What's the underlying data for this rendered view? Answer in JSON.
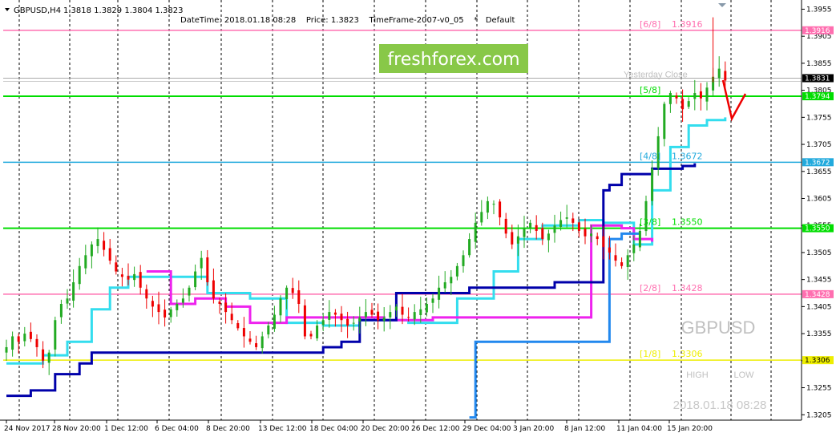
{
  "header": {
    "symbol": "GBPUSD,H4",
    "ohlc": "1.3818 1.3829 1.3804 1.3823",
    "indicator_info": "DateTime: 2018.01.18 08:28    Price: 1.3823    TimeFrame-2007-v0_05    *   Default"
  },
  "watermark": {
    "logo": "freshforex.com",
    "symbol": "GBPUSD",
    "high": "HIGH",
    "low": "LOW",
    "datetime": "2018.01.18 08:28"
  },
  "colors": {
    "bull": "#22aa22",
    "bear": "#ee0000",
    "level_pink": "#ff6fb0",
    "level_green": "#00dd00",
    "level_cyan": "#22aadd",
    "level_yellow": "#eeee00",
    "cyan_line": "#33ddee",
    "magenta_line": "#ee22ee",
    "navy_line": "#0000aa",
    "blue_line": "#2288ee",
    "logo_bg": "#88c848",
    "arrow": "#ee0000"
  },
  "chart_data": {
    "type": "candlestick",
    "symbol": "GBPUSD",
    "timeframe": "H4",
    "ylim": [
      1.3195,
      1.3972
    ],
    "y_ticks": [
      "1.3955",
      "1.3905",
      "1.3855",
      "1.3805",
      "1.3755",
      "1.3705",
      "1.3655",
      "1.3605",
      "1.3555",
      "1.3505",
      "1.3455",
      "1.3405",
      "1.3355",
      "1.3305",
      "1.3255",
      "1.3205"
    ],
    "x_ticks": [
      "24 Nov 2017",
      "28 Nov 20:00",
      "1 Dec 12:00",
      "6 Dec 04:00",
      "8 Dec 20:00",
      "13 Dec 12:00",
      "18 Dec 04:00",
      "20 Dec 20:00",
      "26 Dec 12:00",
      "29 Dec 04:00",
      "3 Jan 20:00",
      "8 Jan 12:00",
      "11 Jan 04:00",
      "15 Jan 20:00"
    ],
    "current_price": 1.3823,
    "current_price_label": "1.3831",
    "murrey_levels": [
      {
        "label": "[6/8]",
        "value_text": "1.3916",
        "value": 1.3916,
        "tag": "1.3916",
        "color": "level_pink"
      },
      {
        "label": "[5/8]",
        "value_text": "",
        "value": 1.3794,
        "tag": "1.3794",
        "color": "level_green"
      },
      {
        "label": "[4/8]",
        "value_text": "1.3672",
        "value": 1.3672,
        "tag": "1.3672",
        "color": "level_cyan"
      },
      {
        "label": "[3/8]",
        "value_text": "1.3550",
        "value": 1.355,
        "tag": "1.3550",
        "color": "level_green"
      },
      {
        "label": "[2/8]",
        "value_text": "1.3428",
        "value": 1.3428,
        "tag": "1.3428",
        "color": "level_pink"
      },
      {
        "label": "[1/8]",
        "value_text": "1.3306",
        "value": 1.3306,
        "tag": "1.3306",
        "color": "level_yellow"
      }
    ],
    "close_line_label": "Yesterday Close",
    "closes": [
      1.333,
      1.335,
      1.334,
      1.3355,
      1.3345,
      1.333,
      1.3305,
      1.332,
      1.338,
      1.341,
      1.342,
      1.345,
      1.348,
      1.35,
      1.352,
      1.353,
      1.351,
      1.349,
      1.347,
      1.346,
      1.3455,
      1.3465,
      1.344,
      1.342,
      1.3405,
      1.3395,
      1.3385,
      1.34,
      1.341,
      1.342,
      1.344,
      1.347,
      1.3495,
      1.345,
      1.342,
      1.341,
      1.3395,
      1.338,
      1.3365,
      1.335,
      1.334,
      1.333,
      1.335,
      1.337,
      1.339,
      1.342,
      1.344,
      1.343,
      1.341,
      1.335,
      1.335,
      1.337,
      1.338,
      1.3395,
      1.339,
      1.338,
      1.337,
      1.3375,
      1.3385,
      1.3395,
      1.339,
      1.338,
      1.3385,
      1.3395,
      1.3405,
      1.339,
      1.3385,
      1.3395,
      1.34,
      1.341,
      1.342,
      1.344,
      1.345,
      1.346,
      1.348,
      1.35,
      1.353,
      1.356,
      1.358,
      1.36,
      1.3595,
      1.357,
      1.354,
      1.352,
      1.3535,
      1.355,
      1.356,
      1.3545,
      1.353,
      1.354,
      1.3555,
      1.3565,
      1.357,
      1.356,
      1.3545,
      1.3535,
      1.354,
      1.353,
      1.3515,
      1.3505,
      1.349,
      1.348,
      1.35,
      1.352,
      1.3545,
      1.36,
      1.366,
      1.372,
      1.378,
      1.38,
      1.379,
      1.377,
      1.3785,
      1.38,
      1.379,
      1.381,
      1.383,
      1.3845,
      1.3823
    ],
    "series": [
      {
        "name": "",
        "color": "cyan_line",
        "points": [
          [
            0,
            1.33
          ],
          [
            6,
            1.3315
          ],
          [
            10,
            1.334
          ],
          [
            14,
            1.34
          ],
          [
            17,
            1.344
          ],
          [
            20,
            1.346
          ],
          [
            28,
            1.346
          ],
          [
            33,
            1.343
          ],
          [
            40,
            1.342
          ],
          [
            46,
            1.3375
          ],
          [
            52,
            1.337
          ],
          [
            58,
            1.338
          ],
          [
            66,
            1.3375
          ],
          [
            74,
            1.342
          ],
          [
            80,
            1.347
          ],
          [
            84,
            1.353
          ],
          [
            88,
            1.3555
          ],
          [
            94,
            1.3565
          ],
          [
            98,
            1.356
          ],
          [
            103,
            1.352
          ],
          [
            106,
            1.362
          ],
          [
            109,
            1.37
          ],
          [
            112,
            1.374
          ],
          [
            115,
            1.375
          ],
          [
            118,
            1.3755
          ]
        ]
      },
      {
        "name": "",
        "color": "magenta_line",
        "points": [
          [
            23,
            1.347
          ],
          [
            25,
            1.347
          ],
          [
            27,
            1.341
          ],
          [
            31,
            1.342
          ],
          [
            36,
            1.3405
          ],
          [
            40,
            1.3375
          ],
          [
            45,
            1.3375
          ],
          [
            46,
            1.3385
          ],
          [
            56,
            1.3385
          ],
          [
            62,
            1.338
          ],
          [
            70,
            1.3385
          ],
          [
            96,
            1.3555
          ],
          [
            101,
            1.355
          ],
          [
            103,
            1.353
          ],
          [
            106,
            1.3525
          ]
        ]
      },
      {
        "name": "",
        "color": "navy_line",
        "points": [
          [
            0,
            1.324
          ],
          [
            4,
            1.325
          ],
          [
            8,
            1.328
          ],
          [
            12,
            1.33
          ],
          [
            14,
            1.332
          ],
          [
            48,
            1.332
          ],
          [
            52,
            1.333
          ],
          [
            55,
            1.334
          ],
          [
            58,
            1.338
          ],
          [
            64,
            1.343
          ],
          [
            73,
            1.343
          ],
          [
            76,
            1.344
          ],
          [
            90,
            1.345
          ],
          [
            97,
            1.345
          ],
          [
            98,
            1.362
          ],
          [
            99,
            1.363
          ],
          [
            101,
            1.365
          ],
          [
            106,
            1.366
          ],
          [
            111,
            1.3665
          ],
          [
            113,
            1.367
          ]
        ]
      },
      {
        "name": "",
        "color": "blue_line",
        "points": [
          [
            76,
            1.32
          ],
          [
            77,
            1.334
          ],
          [
            98,
            1.334
          ],
          [
            99,
            1.353
          ],
          [
            101,
            1.354
          ],
          [
            104,
            1.354
          ]
        ]
      }
    ]
  }
}
